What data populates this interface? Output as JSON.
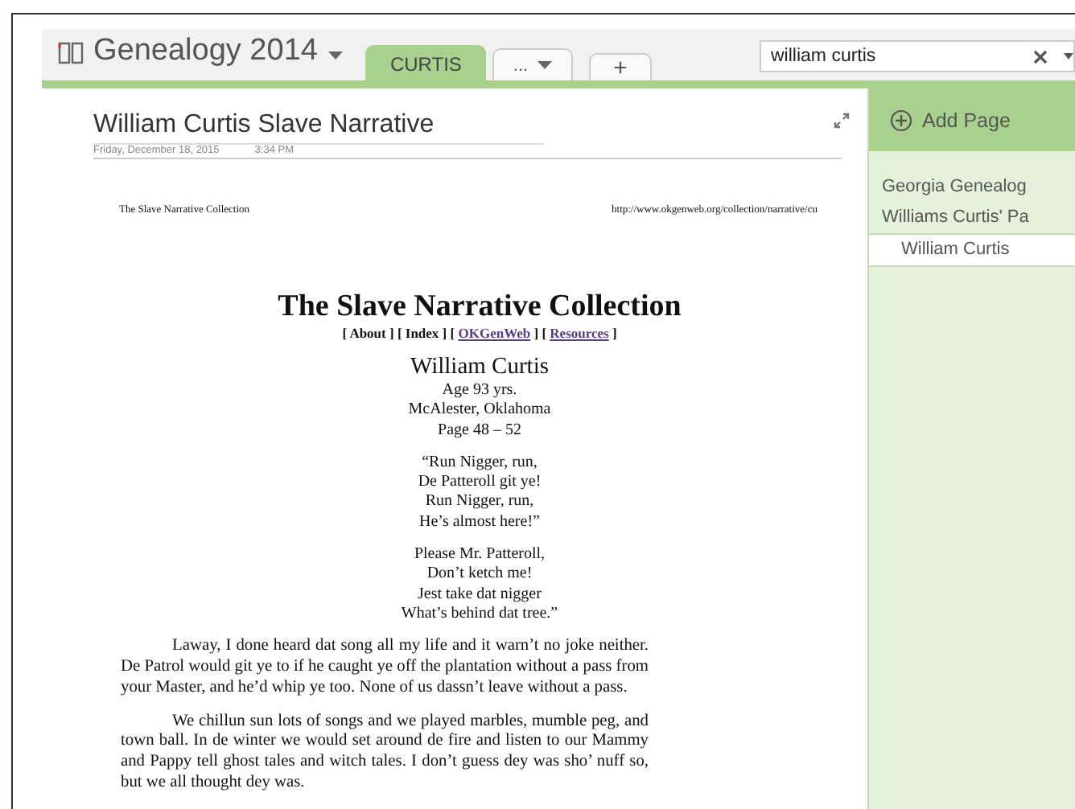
{
  "notebook": {
    "title": "Genealogy 2014"
  },
  "section_tabs": [
    {
      "label": "CURTIS",
      "selected": true
    },
    {
      "label": "...",
      "selected": false
    }
  ],
  "new_tab": {
    "label": "+"
  },
  "search": {
    "value": "william curtis"
  },
  "page": {
    "title": "William Curtis Slave Narrative",
    "date": "Friday, December 18, 2015",
    "time": "3:34 PM",
    "document": {
      "header_left": "The Slave Narrative Collection",
      "header_right": "http://www.okgenweb.org/collection/narrative/cu",
      "heading": "The Slave Narrative Collection",
      "nav": [
        {
          "kind": "text",
          "text": "[ About ] [ Index ] ["
        },
        {
          "kind": "link",
          "text": "OKGenWeb"
        },
        {
          "kind": "text",
          "text": "] ["
        },
        {
          "kind": "link",
          "text": "Resources"
        },
        {
          "kind": "text",
          "text": "]"
        }
      ],
      "subject": "William Curtis",
      "details": [
        "Age 93 yrs.",
        "McAlester, Oklahoma",
        "Page 48 – 52"
      ],
      "verses": [
        [
          "“Run Nigger, run,",
          "De Patteroll git ye!",
          "Run Nigger, run,",
          "He’s almost here!”"
        ],
        [
          "Please Mr. Patteroll,",
          "Don’t ketch me!",
          "Jest take dat nigger",
          "What’s behind dat tree.”"
        ]
      ],
      "paragraphs": [
        "Laway, I done heard dat song all my life and it warn’t no joke neither. De Patrol would git ye to if he caught ye off the plantation without a pass from your Master, and he’d whip ye too. None of us dassn’t leave without a pass.",
        "We chillun sun lots of songs and we played marbles, mumble peg, and town ball. In de winter we would set around de fire and listen to our Mammy and Pappy tell ghost tales and witch tales. I don’t guess dey was sho’ nuff so, but we all thought dey was."
      ]
    }
  },
  "sidebar": {
    "add_page": "Add Page",
    "pages": [
      {
        "label": "Georgia Genealog",
        "selected": false
      },
      {
        "label": "Williams Curtis' Pa",
        "selected": false
      },
      {
        "label": "William Curtis",
        "selected": true
      }
    ]
  }
}
